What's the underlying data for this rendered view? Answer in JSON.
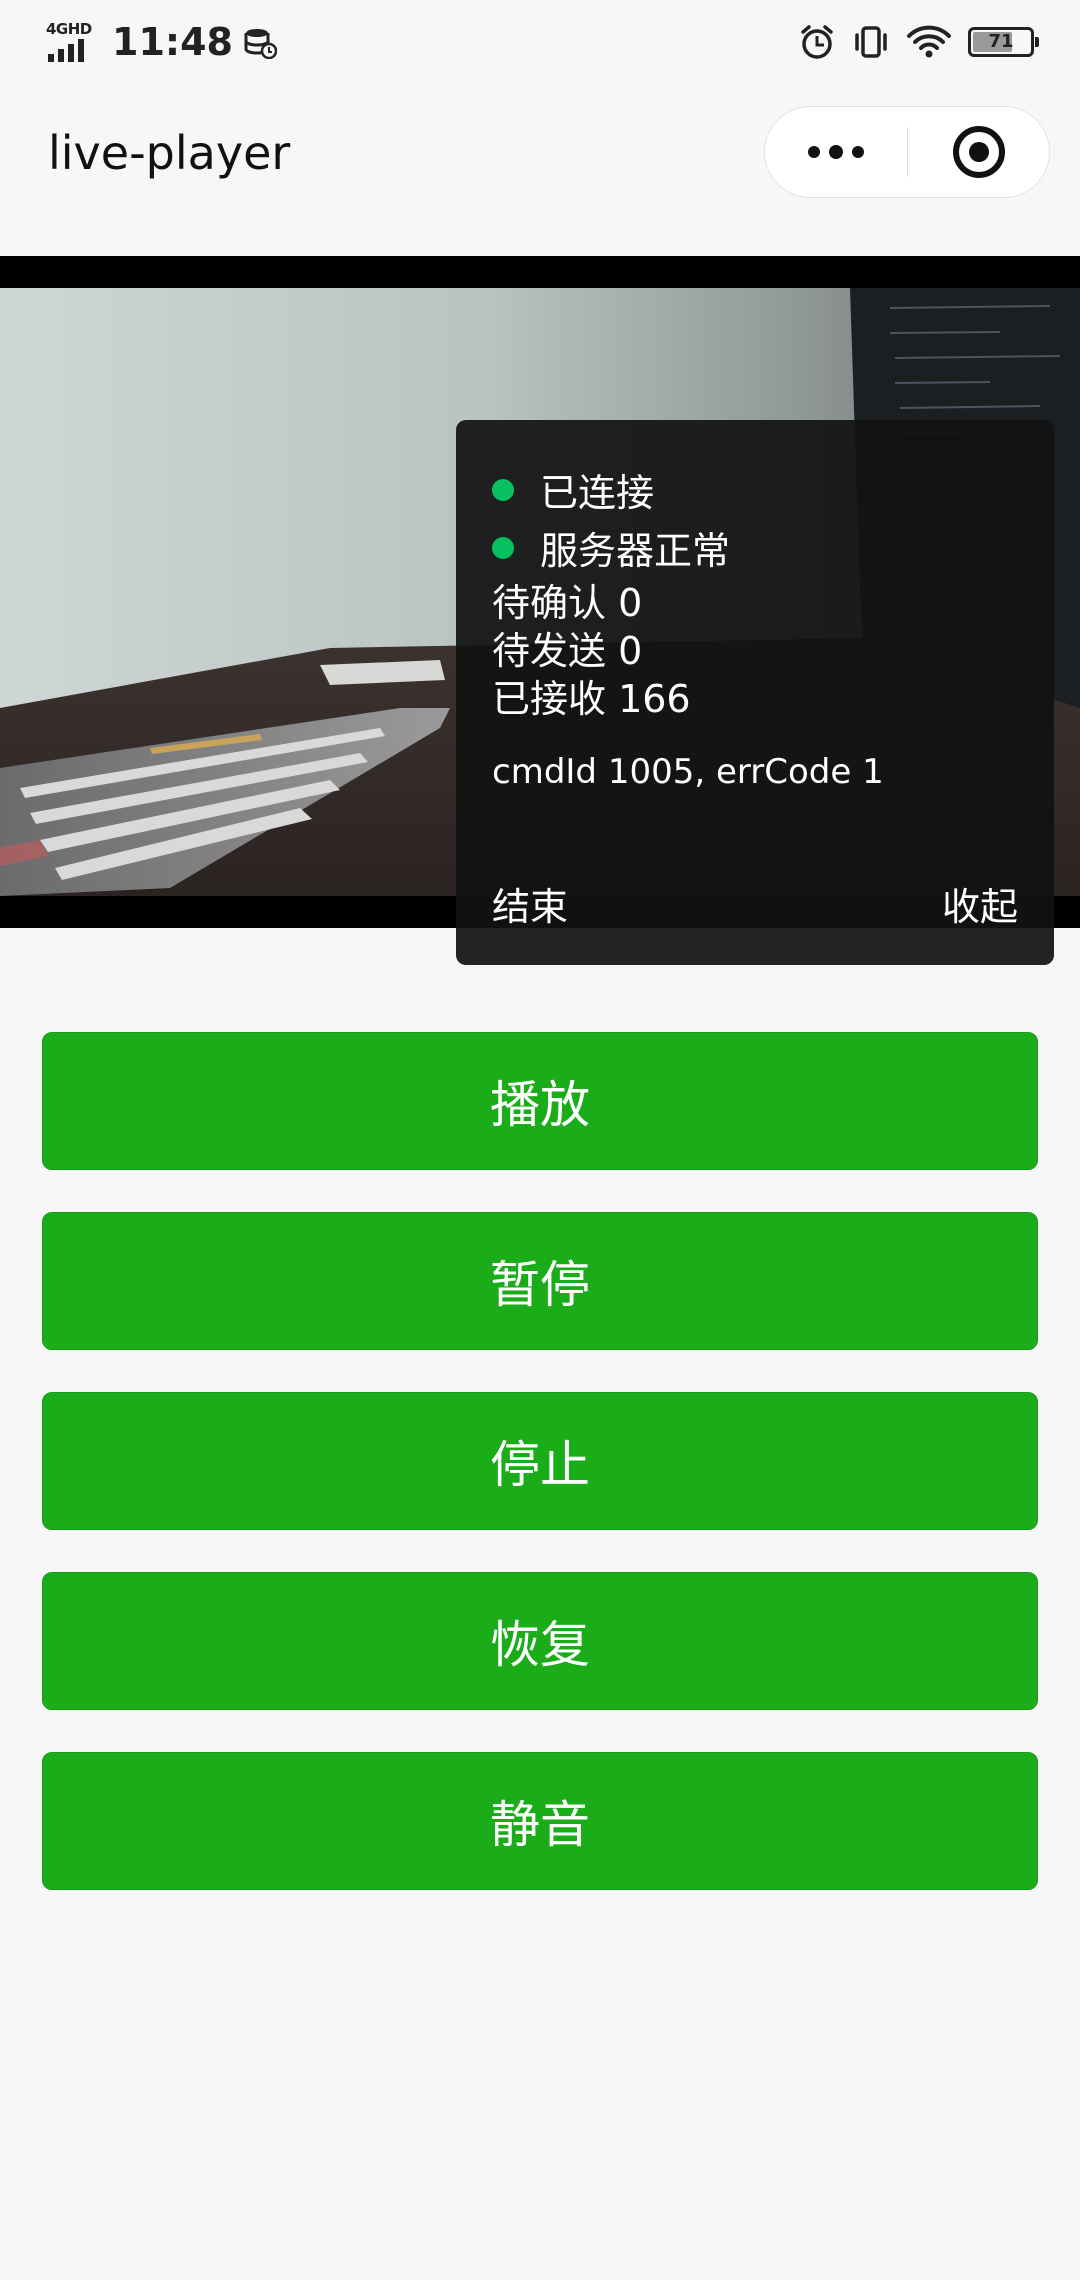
{
  "status_bar": {
    "network": "4GHD",
    "time": "11:48",
    "battery": "71",
    "battery_level": 0.71
  },
  "nav": {
    "title": "live-player"
  },
  "debug_panel": {
    "status_items": [
      {
        "label": "已连接",
        "color": "#07c160"
      },
      {
        "label": "服务器正常",
        "color": "#07c160"
      }
    ],
    "stats": [
      "待确认 0",
      "待发送 0",
      "已接收 166"
    ],
    "cmd": "cmdId 1005, errCode 1",
    "end_label": "结束",
    "collapse_label": "收起"
  },
  "buttons": [
    "播放",
    "暂停",
    "停止",
    "恢复",
    "静音"
  ],
  "colors": {
    "primary_button": "#1aad19",
    "status_dot": "#07c160"
  }
}
